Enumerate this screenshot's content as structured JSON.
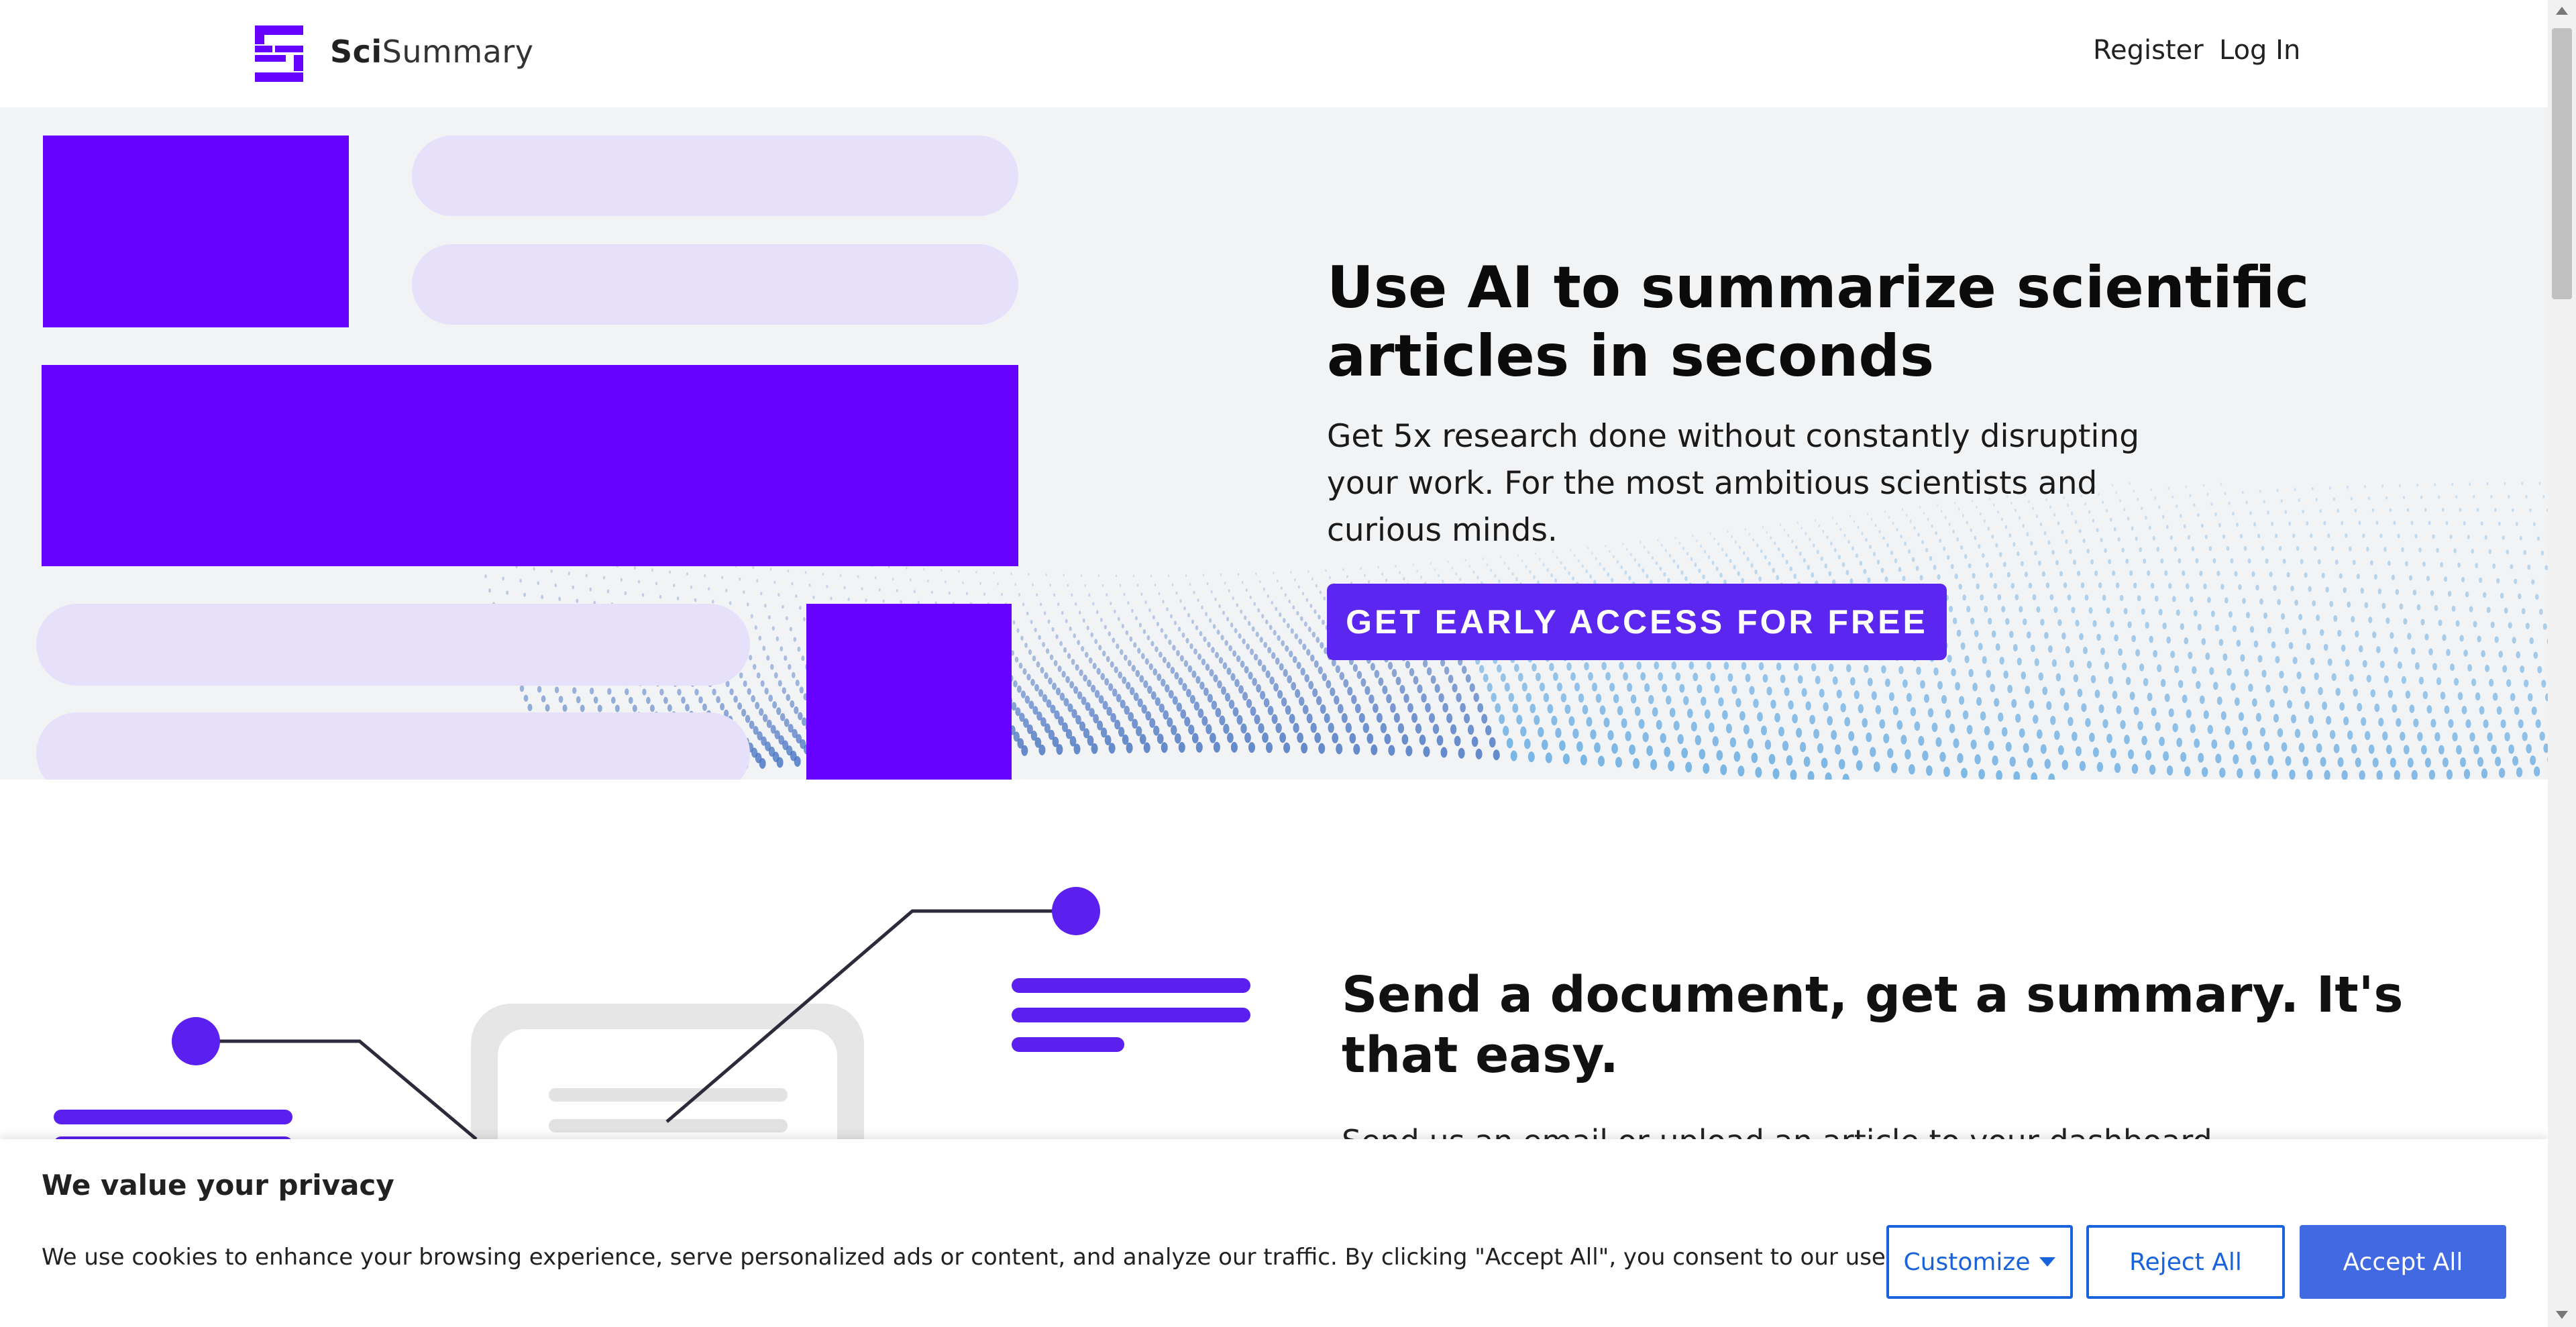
{
  "header": {
    "brand_bold": "Sci",
    "brand_rest": "Summary",
    "nav": {
      "register": "Register",
      "login": "Log In"
    }
  },
  "hero": {
    "title": "Use AI to summarize scientific articles in seconds",
    "subtitle": "Get 5x research done without constantly disrupting your work. For the most ambitious scientists and curious minds.",
    "cta": "GET EARLY ACCESS FOR FREE"
  },
  "section2": {
    "title": "Send a document, get a summary. It's that easy.",
    "text": "Send us an email or upload an article to your dashboard with text or links"
  },
  "cookie_banner": {
    "title": "We value your privacy",
    "text": "We use cookies to enhance your browsing experience, serve personalized ads or content, and analyze our traffic. By clicking \"Accept All\", you consent to our use of cookies.",
    "customize": "Customize",
    "reject": "Reject All",
    "accept": "Accept All"
  },
  "colors": {
    "brand_purple": "#6600ff",
    "cta_purple": "#5b26f0",
    "pill_lavender": "#e6e0fb",
    "cookie_blue": "#1863dc",
    "accept_blue": "#4169e1"
  }
}
